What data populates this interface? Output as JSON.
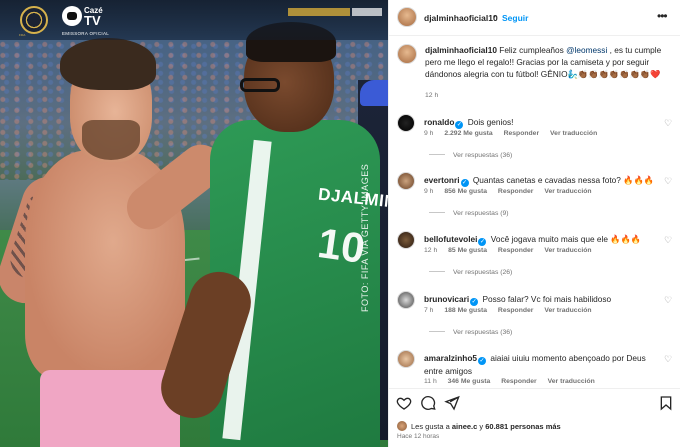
{
  "photo": {
    "credit": "FOTO: FIFA VIA GETTY IMAGES",
    "jersey_name": "DJALMINHA",
    "jersey_number": "10",
    "broadcaster": {
      "logo_caption": "FIFA",
      "name_top": "Cazé",
      "name_bottom": "TV",
      "tagline": "EMISSORA OFICIAL"
    }
  },
  "header": {
    "username": "djalminhaoficial10",
    "separator": "•",
    "follow_label": "Seguir",
    "more_label": "•••"
  },
  "caption": {
    "username": "djalminhaoficial10",
    "text_before": "Feliz cumpleaños ",
    "mention": "@leomessi",
    "text_after": " , es tu cumple pero me llego el regalo!! Gracias por la camiseta y por seguir dándonos alegria con tu fútbol! GÊNIO🧞‍♂️👏🏾👏🏾👏🏾👏🏾👏🏾👏🏾👏🏾❤️",
    "time": "12 h"
  },
  "comments": [
    {
      "username": "ronaldo",
      "verified": true,
      "text": "Dois genios!",
      "time": "9 h",
      "likes": "2.292 Me gusta",
      "reply": "Responder",
      "translate": "Ver traducción",
      "replies": "Ver respuestas (36)"
    },
    {
      "username": "evertonri",
      "verified": true,
      "text": "Quantas canetas e cavadas nessa foto? 🔥🔥🔥",
      "time": "9 h",
      "likes": "856 Me gusta",
      "reply": "Responder",
      "translate": "Ver traducción",
      "replies": "Ver respuestas (9)"
    },
    {
      "username": "bellofutevolei",
      "verified": true,
      "text": "Você jogava muito mais que ele 🔥🔥🔥",
      "time": "12 h",
      "likes": "85 Me gusta",
      "reply": "Responder",
      "translate": "Ver traducción",
      "replies": "Ver respuestas (26)"
    },
    {
      "username": "brunovicari",
      "verified": true,
      "text": "Posso falar? Vc foi mais habilidoso",
      "time": "7 h",
      "likes": "188 Me gusta",
      "reply": "Responder",
      "translate": "Ver traducción",
      "replies": "Ver respuestas (36)"
    },
    {
      "username": "amaralzinho5",
      "verified": true,
      "text": "aiaiai uiuiu momento abençoado por Deus entre amigos",
      "time": "11 h",
      "likes": "346 Me gusta",
      "reply": "Responder",
      "translate": "Ver traducción",
      "replies": ""
    }
  ],
  "footer": {
    "likes_prefix": "Les gusta a ",
    "likes_user": "ainee.c",
    "likes_mid": " y ",
    "likes_count": "60.881 personas más",
    "timestamp": "Hace 12 horas",
    "icons": [
      "heart-icon",
      "comment-icon",
      "share-icon",
      "bookmark-icon"
    ]
  },
  "colors": {
    "accent": "#0095f6",
    "mention": "#00376b",
    "muted": "#737373",
    "jersey": "#1f7a40",
    "shorts": "#f0a6c4"
  }
}
